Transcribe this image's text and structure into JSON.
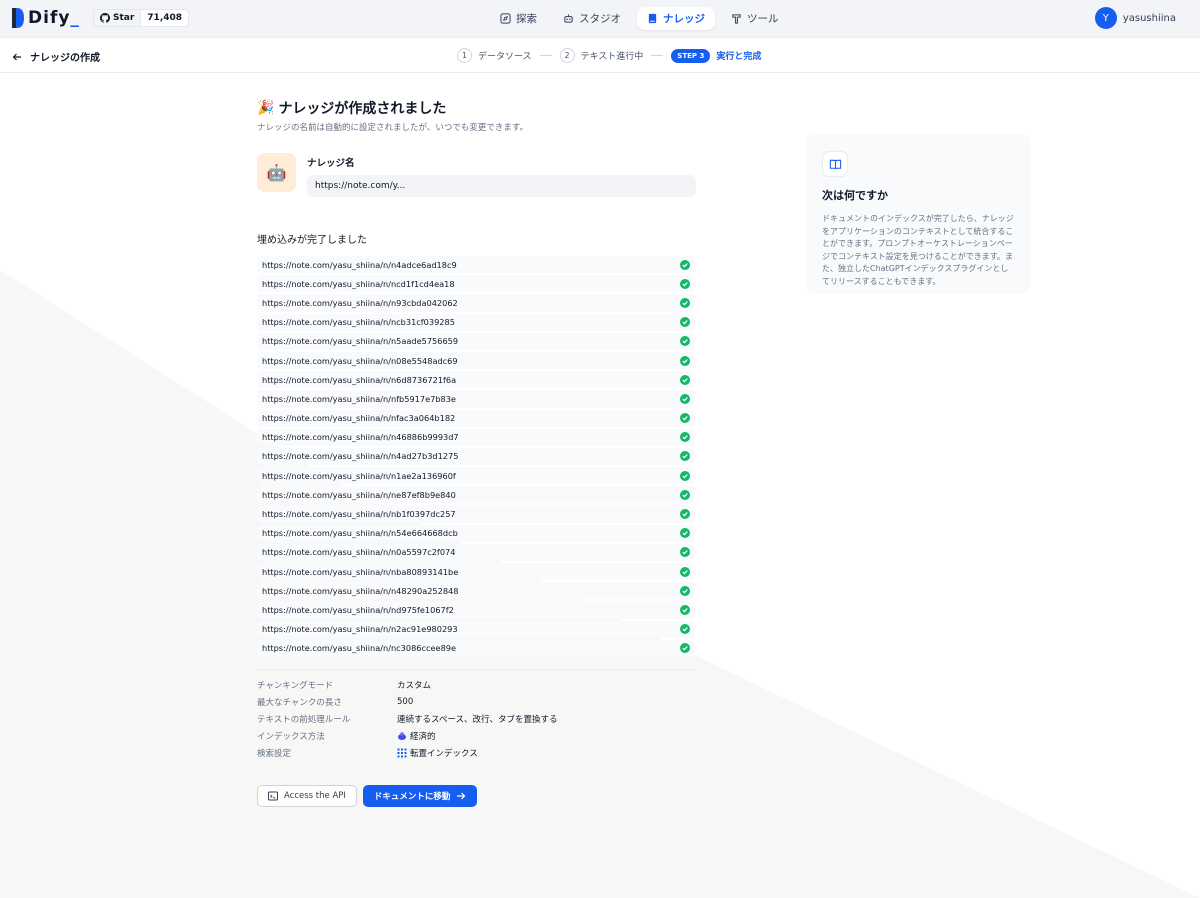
{
  "header": {
    "logo_text": "Dify",
    "github_star_label": "Star",
    "github_count": "71,408",
    "nav": [
      {
        "label": "探索",
        "icon": "compass-icon",
        "active": false
      },
      {
        "label": "スタジオ",
        "icon": "robot-icon",
        "active": false
      },
      {
        "label": "ナレッジ",
        "icon": "book-icon",
        "active": true
      },
      {
        "label": "ツール",
        "icon": "hammer-icon",
        "active": false
      }
    ],
    "user": {
      "initial": "Y",
      "name": "yasushiina"
    }
  },
  "stepbar": {
    "back_label": "ナレッジの作成",
    "steps": [
      {
        "num": "1",
        "label": "データソース"
      },
      {
        "num": "2",
        "label": "テキスト進行中"
      },
      {
        "pill": "STEP 3",
        "label": "実行と完成"
      }
    ]
  },
  "main": {
    "title_emoji": "🎉",
    "title": "ナレッジが作成されました",
    "subtitle": "ナレッジの名前は自動的に設定されましたが、いつでも変更できます。",
    "knowledge_icon": "🤖",
    "knowledge_label": "ナレッジ名",
    "knowledge_name": "https://note.com/y...",
    "embed_title": "埋め込みが完了しました",
    "documents": [
      "https://note.com/yasu_shiina/n/n4adce6ad18c9",
      "https://note.com/yasu_shiina/n/ncd1f1cd4ea18",
      "https://note.com/yasu_shiina/n/n93cbda042062",
      "https://note.com/yasu_shiina/n/ncb31cf039285",
      "https://note.com/yasu_shiina/n/n5aade5756659",
      "https://note.com/yasu_shiina/n/n08e5548adc69",
      "https://note.com/yasu_shiina/n/n6d8736721f6a",
      "https://note.com/yasu_shiina/n/nfb5917e7b83e",
      "https://note.com/yasu_shiina/n/nfac3a064b182",
      "https://note.com/yasu_shiina/n/n46886b9993d7",
      "https://note.com/yasu_shiina/n/n4ad27b3d1275",
      "https://note.com/yasu_shiina/n/n1ae2a136960f",
      "https://note.com/yasu_shiina/n/ne87ef8b9e840",
      "https://note.com/yasu_shiina/n/nb1f0397dc257",
      "https://note.com/yasu_shiina/n/n54e664668dcb",
      "https://note.com/yasu_shiina/n/n0a5597c2f074",
      "https://note.com/yasu_shiina/n/nba80893141be",
      "https://note.com/yasu_shiina/n/n48290a252848",
      "https://note.com/yasu_shiina/n/nd975fe1067f2",
      "https://note.com/yasu_shiina/n/n2ac91e980293",
      "https://note.com/yasu_shiina/n/nc3086ccee89e"
    ],
    "meta": [
      {
        "key": "チャンキングモード",
        "value": "カスタム",
        "icon": ""
      },
      {
        "key": "最大なチャンクの長さ",
        "value": "500",
        "icon": ""
      },
      {
        "key": "テキストの前処理ルール",
        "value": "連続するスペース、改行、タブを置換する",
        "icon": ""
      },
      {
        "key": "インデックス方法",
        "value": "経済的",
        "icon": "economy-icon"
      },
      {
        "key": "検索設定",
        "value": "転置インデックス",
        "icon": "grid-icon"
      }
    ],
    "api_button": "Access the API",
    "primary_button": "ドキュメントに移動"
  },
  "side": {
    "title": "次は何ですか",
    "text": "ドキュメントのインデックスが完了したら、ナレッジをアプリケーションのコンテキストとして統合することができます。プロンプトオーケストレーションページでコンテキスト設定を見つけることができます。また、独立したChatGPTインデックスプラグインとしてリリースすることもできます。"
  },
  "colors": {
    "accent": "#155eef",
    "success": "#12b76a"
  }
}
